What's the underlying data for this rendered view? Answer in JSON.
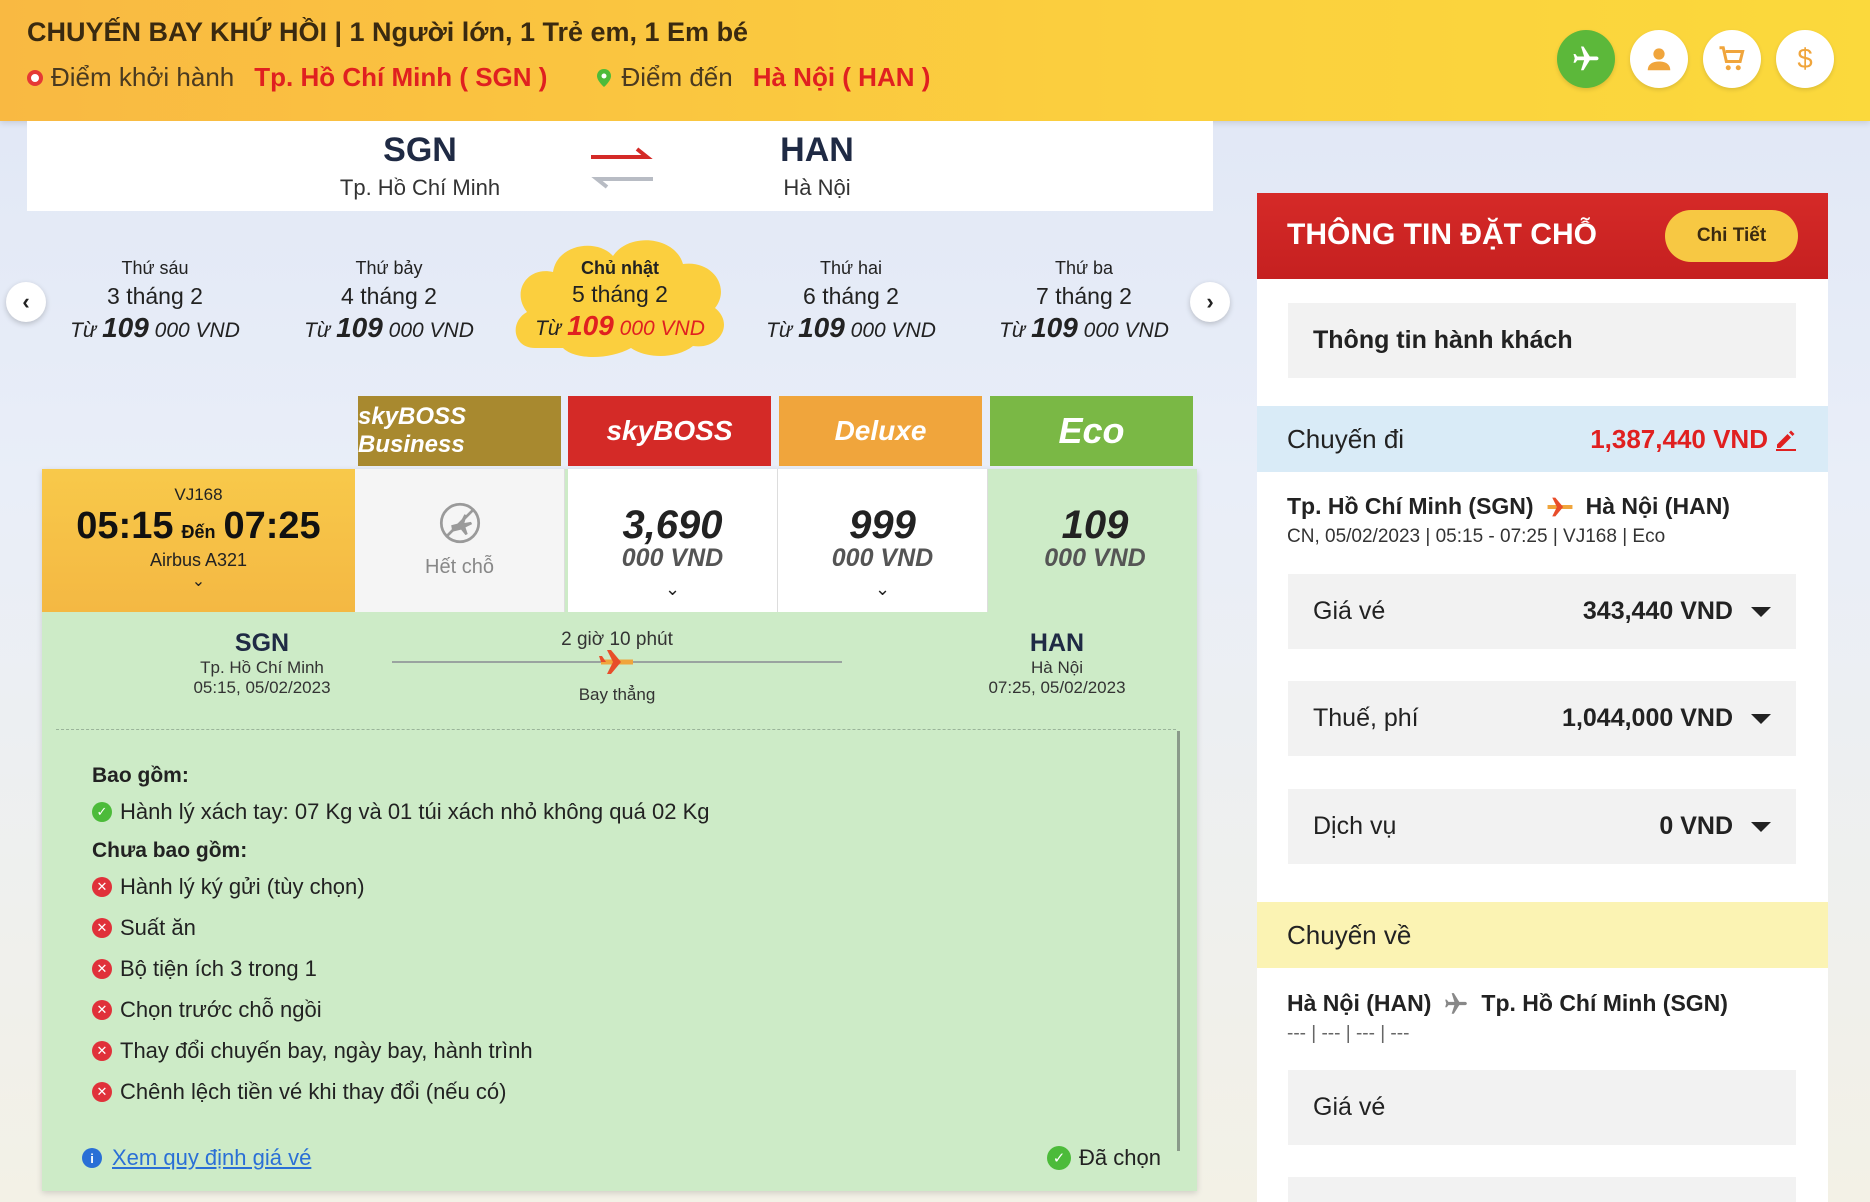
{
  "header": {
    "title": "CHUYẾN BAY KHỨ HỒI | 1 Người lớn, 1 Trẻ em, 1 Em bé",
    "from_label": "Điểm khởi hành",
    "from_city": "Tp. Hồ Chí Minh ( SGN )",
    "to_label": "Điểm đến",
    "to_city": "Hà Nội ( HAN )",
    "icons": [
      "plane-icon",
      "user-icon",
      "cart-icon",
      "dollar-icon"
    ]
  },
  "route": {
    "from_code": "SGN",
    "from_city": "Tp. Hồ Chí Minh",
    "to_code": "HAN",
    "to_city": "Hà Nội"
  },
  "dates": [
    {
      "dow": "Thứ sáu",
      "dm": "3 tháng 2",
      "prefix": "Từ",
      "price": "109",
      "rest": "000 VND"
    },
    {
      "dow": "Thứ bảy",
      "dm": "4 tháng 2",
      "prefix": "Từ",
      "price": "109",
      "rest": "000 VND"
    },
    {
      "dow": "Chủ nhật",
      "dm": "5 tháng 2",
      "prefix": "Từ",
      "price": "109",
      "rest": "000 VND"
    },
    {
      "dow": "Thứ hai",
      "dm": "6 tháng 2",
      "prefix": "Từ",
      "price": "109",
      "rest": "000 VND"
    },
    {
      "dow": "Thứ ba",
      "dm": "7 tháng 2",
      "prefix": "Từ",
      "price": "109",
      "rest": "000 VND"
    }
  ],
  "fare_classes": {
    "business": "skyBOSS Business",
    "skyboss": "skyBOSS",
    "deluxe": "Deluxe",
    "eco": "Eco"
  },
  "flight": {
    "code": "VJ168",
    "depart": "05:15",
    "den": "Đến",
    "arrive": "07:25",
    "aircraft": "Airbus A321",
    "business_status": "Hết chỗ",
    "skyboss_price": "3,690",
    "deluxe_price": "999",
    "eco_price": "109",
    "unit": "000 VND"
  },
  "detail": {
    "from_code": "SGN",
    "from_city": "Tp. Hồ Chí Minh",
    "from_time": "05:15, 05/02/2023",
    "duration": "2 giờ 10 phút",
    "direct": "Bay thẳng",
    "to_code": "HAN",
    "to_city": "Hà Nội",
    "to_time": "07:25, 05/02/2023",
    "included_title": "Bao gồm:",
    "included": [
      "Hành lý xách tay: 07 Kg và 01 túi xách nhỏ không quá 02 Kg"
    ],
    "excluded_title": "Chưa bao gồm:",
    "excluded": [
      "Hành lý ký gửi (tùy chọn)",
      "Suất ăn",
      "Bộ tiện ích 3 trong 1",
      "Chọn trước chỗ ngồi",
      "Thay đổi chuyến bay, ngày bay, hành trình",
      "Chênh lệch tiền vé khi thay đổi (nếu có)"
    ],
    "fare_rules_link": "Xem quy định giá vé",
    "selected_label": "Đã chọn"
  },
  "sidebar": {
    "title": "THÔNG TIN ĐẶT CHỖ",
    "detail_button": "Chi Tiết",
    "passenger_info": "Thông tin hành khách",
    "outbound_label": "Chuyến đi",
    "outbound_amount": "1,387,440 VND",
    "outbound_from": "Tp. Hồ Chí Minh (SGN)",
    "outbound_to": "Hà Nội (HAN)",
    "outbound_sub": "CN, 05/02/2023 | 05:15 - 07:25 | VJ168 | Eco",
    "fare_label": "Giá vé",
    "fare_value": "343,440 VND",
    "tax_label": "Thuế, phí",
    "tax_value": "1,044,000 VND",
    "service_label": "Dịch vụ",
    "service_value": "0 VND",
    "return_label": "Chuyến về",
    "return_from": "Hà Nội (HAN)",
    "return_to": "Tp. Hồ Chí Minh (SGN)",
    "return_sub": "--- | --- | --- | ---",
    "return_fare_label": "Giá vé"
  },
  "colors": {
    "accent_red": "#e02020",
    "header_yellow": "#fbcf3e",
    "eco_green": "#7ab845"
  }
}
